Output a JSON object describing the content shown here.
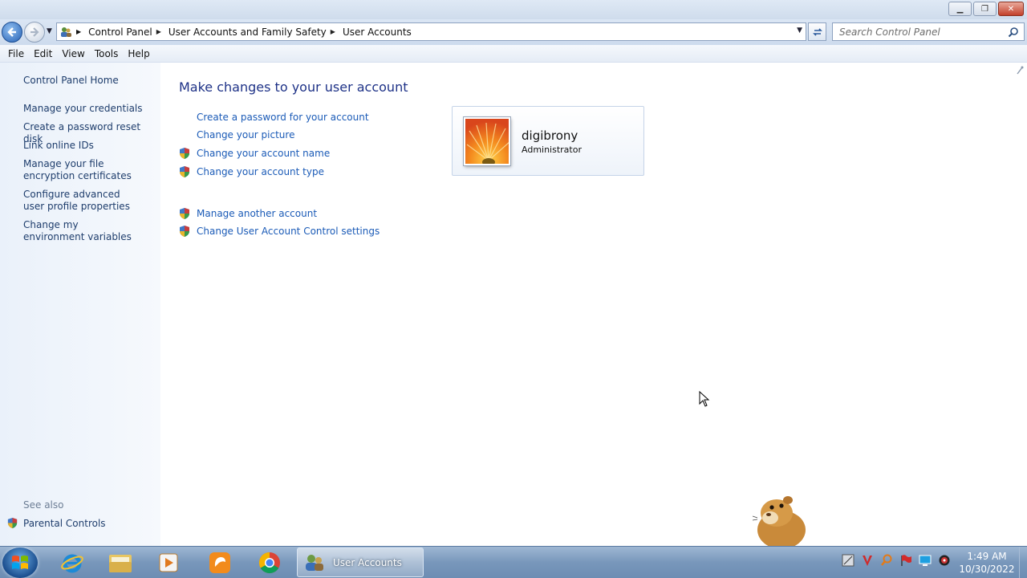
{
  "window": {
    "minimize_label": "▁",
    "maximize_label": "❐",
    "close_label": "✕"
  },
  "address_bar": {
    "breadcrumbs": [
      "Control Panel",
      "User Accounts and Family Safety",
      "User Accounts"
    ],
    "search_placeholder": "Search Control Panel"
  },
  "menu": {
    "items": [
      "File",
      "Edit",
      "View",
      "Tools",
      "Help"
    ]
  },
  "left_pane": {
    "home": "Control Panel Home",
    "links": [
      "Manage your credentials",
      "Create a password reset disk",
      "Link online IDs",
      "Manage your file encryption certificates",
      "Configure advanced user profile properties",
      "Change my environment variables"
    ],
    "see_also": "See also",
    "parental_controls": "Parental Controls"
  },
  "main": {
    "heading": "Make changes to your user account",
    "tasks": [
      "Create a password for your account",
      "Change your picture",
      "Change your account name",
      "Change your account type"
    ],
    "more_tasks": [
      "Manage another account",
      "Change User Account Control settings"
    ]
  },
  "account": {
    "name": "digibrony",
    "role": "Administrator"
  },
  "taskbar": {
    "active_window": "User Accounts",
    "time": "1:49 AM",
    "date": "10/30/2022"
  },
  "colors": {
    "link": "#1b5bb7",
    "heading": "#1e3287",
    "left_link": "#1e3d6c",
    "taskbar": "#7897bb"
  }
}
